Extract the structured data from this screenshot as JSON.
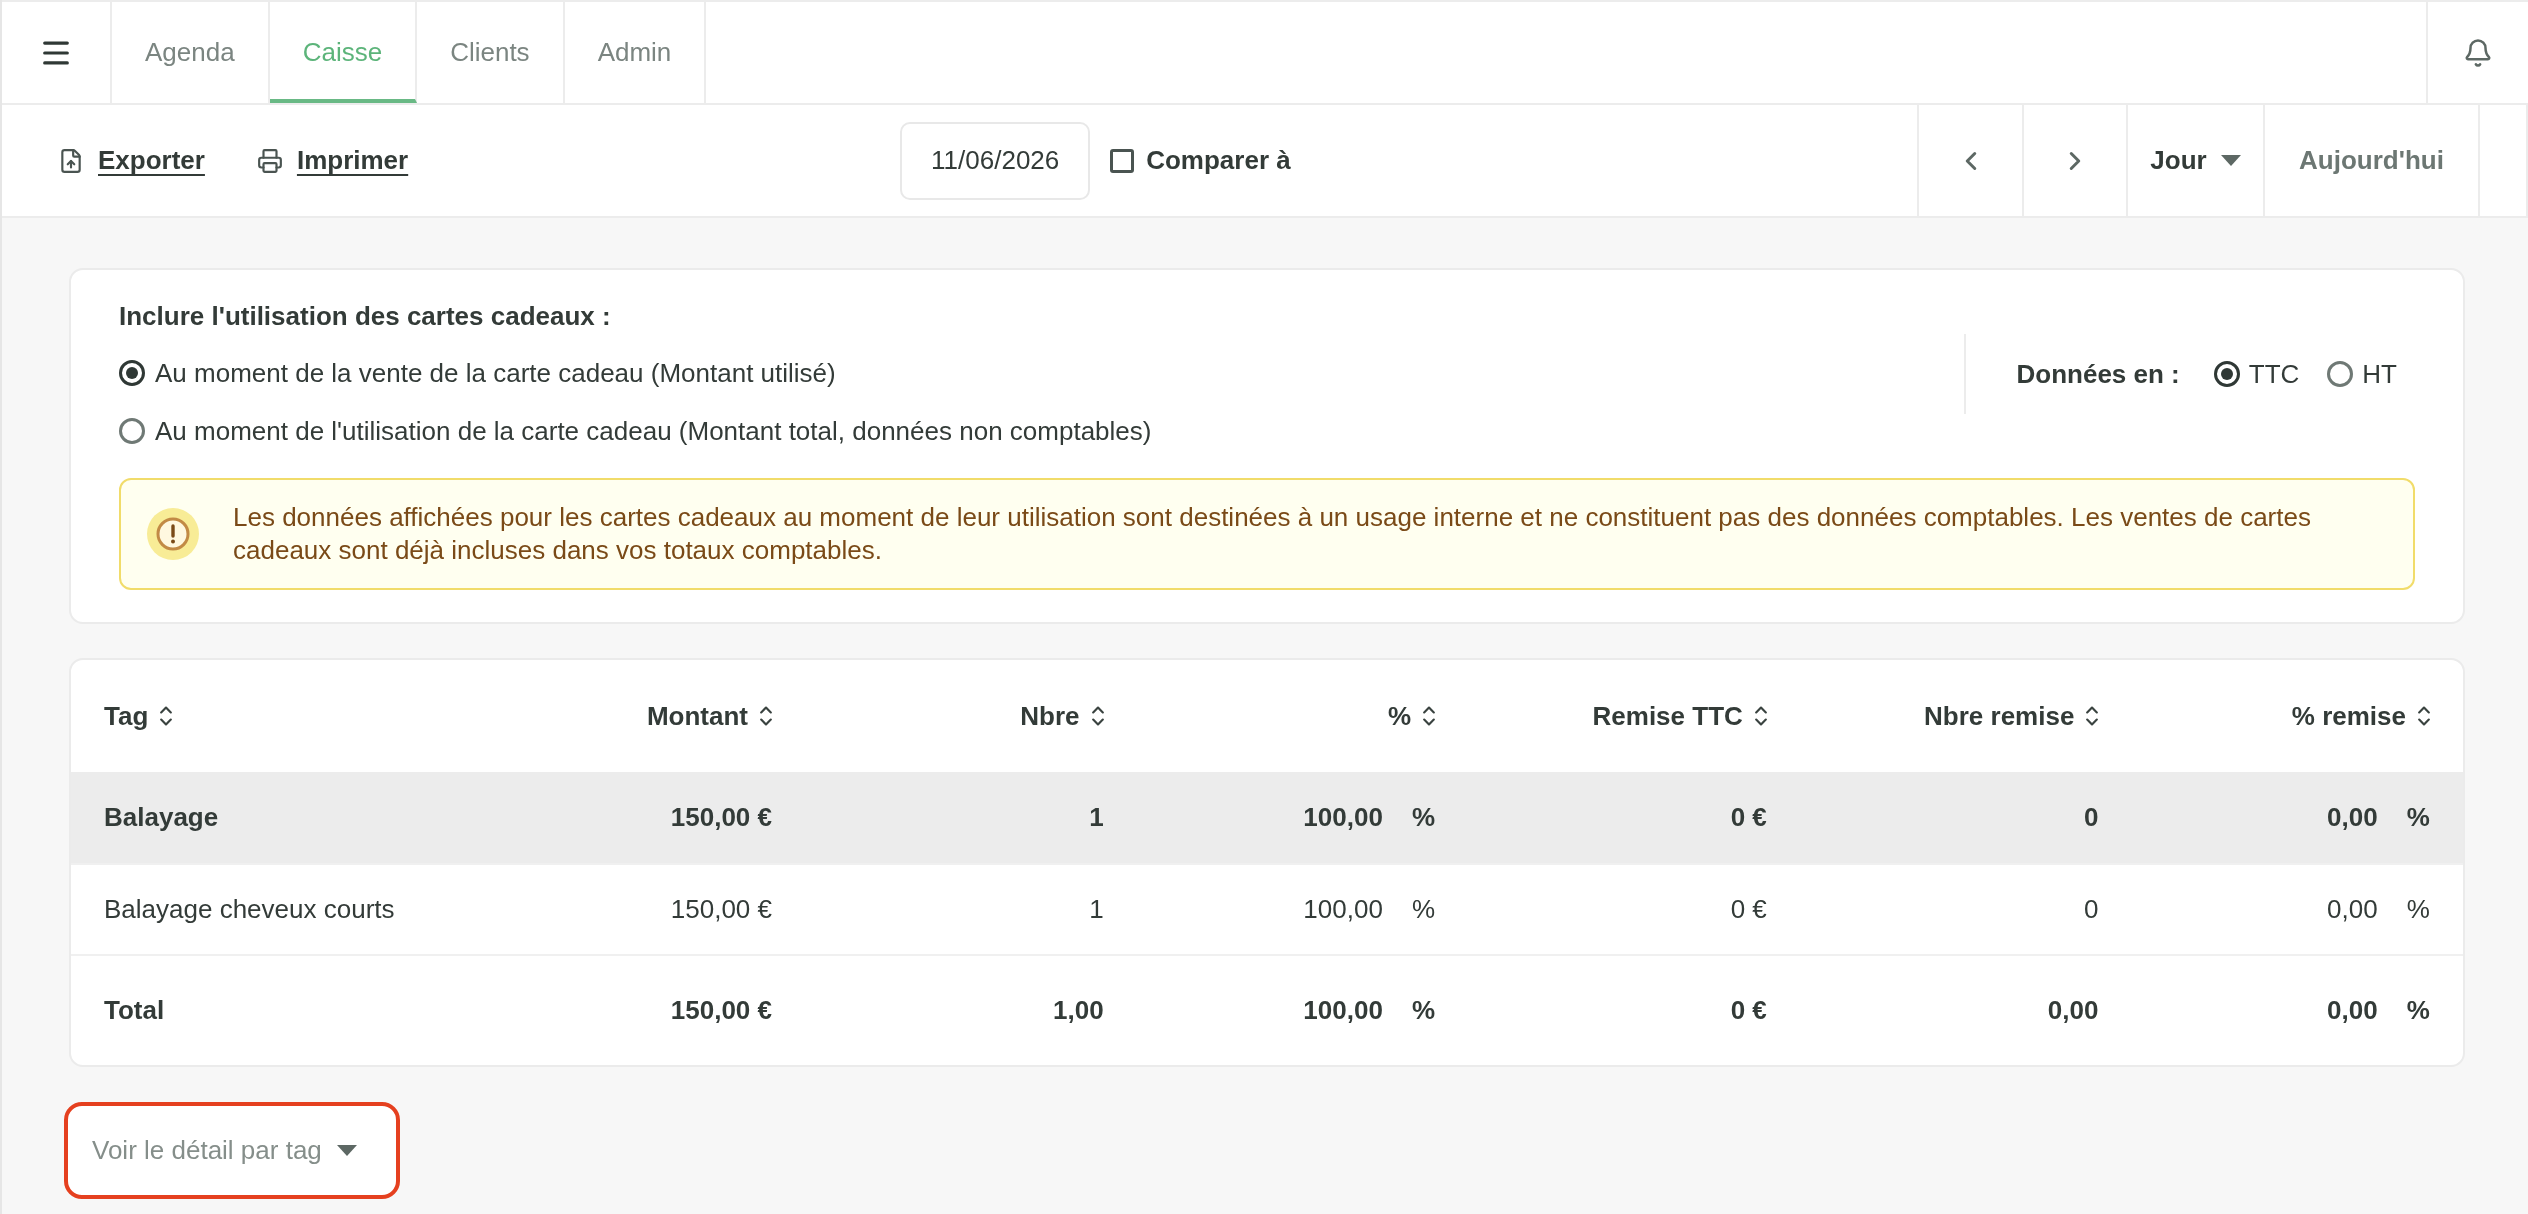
{
  "nav": {
    "tabs": [
      {
        "label": "Agenda",
        "selected": false
      },
      {
        "label": "Caisse",
        "selected": true
      },
      {
        "label": "Clients",
        "selected": false
      },
      {
        "label": "Admin",
        "selected": false
      }
    ]
  },
  "toolbar": {
    "actions": [
      {
        "label": "Exporter",
        "kind": "export"
      },
      {
        "label": "Imprimer",
        "kind": "print"
      }
    ],
    "date": {
      "value": "11/06/2026"
    },
    "compare": {
      "label": "Comparer à",
      "checked": false
    },
    "period": {
      "label": "Jour"
    },
    "today": {
      "label": "Aujourd'hui"
    }
  },
  "gift_cards": {
    "title": "Inclure l'utilisation des cartes cadeaux :",
    "options": [
      {
        "label": "Au moment de la vente de la carte cadeau (Montant utilisé)",
        "selected": true
      },
      {
        "label": "Au moment de l'utilisation de la carte cadeau (Montant total, données non comptables)",
        "selected": false
      }
    ],
    "warning": "Les données affichées pour les cartes cadeaux au moment de leur utilisation sont destinées à un usage interne et ne constituent pas des données comptables. Les ventes de cartes cadeaux sont déjà incluses dans vos totaux comptables."
  },
  "data_mode": {
    "label": "Données en :",
    "options": [
      {
        "label": "TTC",
        "selected": true
      },
      {
        "label": "HT",
        "selected": false
      }
    ]
  },
  "table": {
    "columns": [
      "Tag",
      "Montant",
      "Nbre",
      "%",
      "Remise TTC",
      "Nbre remise",
      "% remise"
    ],
    "rows": [
      {
        "kind": "group",
        "cells": [
          "Balayage",
          "150,00 €",
          "1",
          "100,00 %",
          "0 €",
          "0",
          "0,00 %"
        ]
      },
      {
        "kind": "item",
        "cells": [
          "Balayage cheveux courts",
          "150,00 €",
          "1",
          "100,00 %",
          "0 €",
          "0",
          "0,00 %"
        ]
      }
    ],
    "total": {
      "cells": [
        "Total",
        "150,00 €",
        "1,00",
        "100,00 %",
        "0 €",
        "0,00",
        "0,00 %"
      ]
    }
  },
  "detail_button": {
    "label": "Voir le détail par tag",
    "highlighted": true
  }
}
